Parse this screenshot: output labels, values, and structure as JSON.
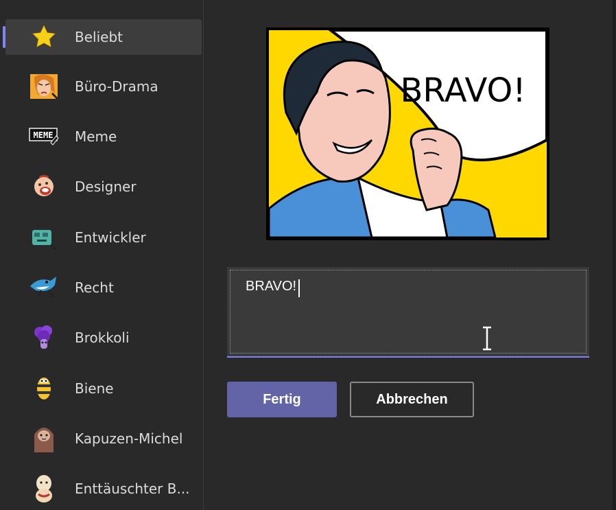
{
  "sidebar": {
    "items": [
      {
        "label": "Beliebt",
        "icon": "star-icon",
        "selected": true
      },
      {
        "label": "Büro-Drama",
        "icon": "office-drama-sticker-icon"
      },
      {
        "label": "Meme",
        "icon": "meme-sticker-icon"
      },
      {
        "label": "Designer",
        "icon": "designer-sticker-icon"
      },
      {
        "label": "Entwickler",
        "icon": "developer-sticker-icon"
      },
      {
        "label": "Recht",
        "icon": "shark-sticker-icon"
      },
      {
        "label": "Brokkoli",
        "icon": "broccoli-sticker-icon"
      },
      {
        "label": "Biene",
        "icon": "bee-sticker-icon"
      },
      {
        "label": "Kapuzen-Michel",
        "icon": "hooded-sloth-sticker-icon"
      },
      {
        "label": "Enttäuschter B...",
        "icon": "disappointed-sticker-icon"
      }
    ]
  },
  "preview": {
    "bubble_text": "BRAVO!"
  },
  "caption": {
    "value": "BRAVO!"
  },
  "buttons": {
    "done": "Fertig",
    "cancel": "Abbrechen"
  },
  "colors": {
    "accent": "#6264a7",
    "accent_light": "#7f85f5",
    "background": "#292929",
    "comic_yellow": "#ffd800",
    "comic_blue": "#4a90d9"
  }
}
